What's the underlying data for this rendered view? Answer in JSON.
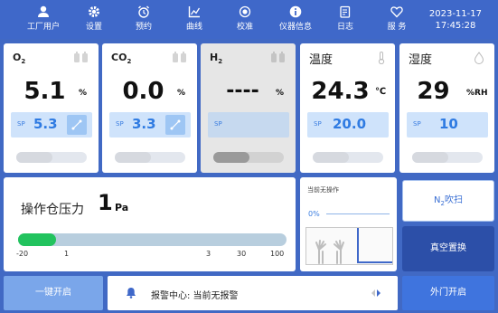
{
  "nav": [
    {
      "label": "工厂用户",
      "icon": "user-icon"
    },
    {
      "label": "设置",
      "icon": "gear-icon"
    },
    {
      "label": "预约",
      "icon": "alarm-clock-icon"
    },
    {
      "label": "曲线",
      "icon": "chart-icon"
    },
    {
      "label": "校准",
      "icon": "target-icon"
    },
    {
      "label": "仪器信息",
      "icon": "info-icon"
    },
    {
      "label": "日志",
      "icon": "log-icon"
    },
    {
      "label": "服 务",
      "icon": "service-icon"
    }
  ],
  "clock": {
    "date": "2023-11-17",
    "time": "17:45:28"
  },
  "cards": [
    {
      "title": "O",
      "title_sub": "2",
      "value": "5.1",
      "unit": "%",
      "sp_label": "SP",
      "sp_value": "5.3"
    },
    {
      "title": "CO",
      "title_sub": "2",
      "value": "0.0",
      "unit": "%",
      "sp_label": "SP",
      "sp_value": "3.3"
    },
    {
      "title": "H",
      "title_sub": "2",
      "value": "----",
      "unit": "%",
      "sp_label": "SP",
      "sp_value": ""
    },
    {
      "title": "温度",
      "title_sub": "",
      "value": "24.3",
      "unit": "℃",
      "sp_label": "SP",
      "sp_value": "20.0"
    },
    {
      "title": "湿度",
      "title_sub": "",
      "value": "29",
      "unit": "%RH",
      "sp_label": "SP",
      "sp_value": "10"
    }
  ],
  "pressure": {
    "label": "操作仓压力",
    "value": "1",
    "unit": "Pa",
    "bar_fraction": 0.14,
    "ticks": [
      "-20",
      "1",
      "3",
      "30",
      "100"
    ],
    "fill_color": "#22c35e"
  },
  "status": {
    "text": "当前无操作",
    "percent": "0%"
  },
  "buttons": {
    "purge_prefix": "N",
    "purge_sub": "2",
    "purge_suffix": "吹扫",
    "vacuum": "真空置换",
    "one_key": "一键开启",
    "outer_door": "外门开启"
  },
  "alarm": {
    "text": "报警中心: 当前无报警"
  },
  "colors": {
    "accent": "#3f68c9",
    "sp": "#2f7be2",
    "ok": "#22c35e"
  }
}
